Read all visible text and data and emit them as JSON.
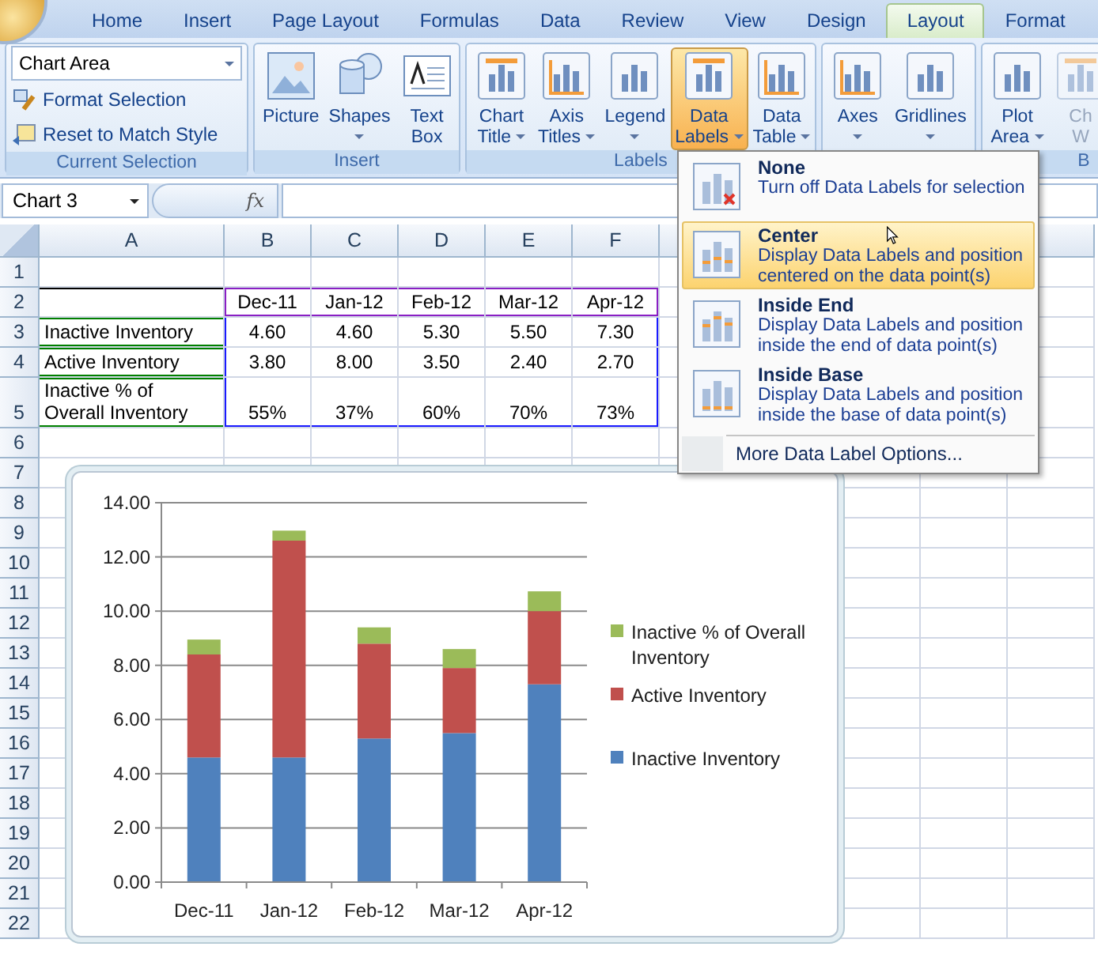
{
  "tabs": [
    {
      "label": "Home",
      "selected": false
    },
    {
      "label": "Insert",
      "selected": false
    },
    {
      "label": "Page Layout",
      "selected": false
    },
    {
      "label": "Formulas",
      "selected": false
    },
    {
      "label": "Data",
      "selected": false
    },
    {
      "label": "Review",
      "selected": false
    },
    {
      "label": "View",
      "selected": false
    },
    {
      "label": "Design",
      "selected": false
    },
    {
      "label": "Layout",
      "selected": true
    },
    {
      "label": "Format",
      "selected": false
    }
  ],
  "ribbon": {
    "selection": {
      "label": "Current Selection",
      "dropdown": "Chart Area",
      "commands": [
        "Format Selection",
        "Reset to Match Style"
      ]
    },
    "groups": [
      {
        "label": "Insert",
        "buttons": [
          {
            "lines": [
              "Picture"
            ],
            "dropdown": false,
            "selected": false,
            "disabled": false
          },
          {
            "lines": [
              "Shapes"
            ],
            "dropdown": true,
            "selected": false,
            "disabled": false
          },
          {
            "lines": [
              "Text",
              "Box"
            ],
            "dropdown": false,
            "selected": false,
            "disabled": false
          }
        ]
      },
      {
        "label": "Labels",
        "buttons": [
          {
            "lines": [
              "Chart",
              "Title"
            ],
            "dropdown": true,
            "selected": false,
            "disabled": false
          },
          {
            "lines": [
              "Axis",
              "Titles"
            ],
            "dropdown": true,
            "selected": false,
            "disabled": false
          },
          {
            "lines": [
              "Legend"
            ],
            "dropdown": true,
            "selected": false,
            "disabled": false
          },
          {
            "lines": [
              "Data",
              "Labels"
            ],
            "dropdown": true,
            "selected": true,
            "disabled": false
          },
          {
            "lines": [
              "Data",
              "Table"
            ],
            "dropdown": true,
            "selected": false,
            "disabled": false
          }
        ]
      },
      {
        "buttons": [
          {
            "lines": [
              "Axes"
            ],
            "dropdown": true,
            "selected": false,
            "disabled": false
          },
          {
            "lines": [
              "Gridlines"
            ],
            "dropdown": true,
            "selected": false,
            "disabled": false
          }
        ]
      },
      {
        "label": "B",
        "buttons": [
          {
            "lines": [
              "Plot",
              "Area"
            ],
            "dropdown": true,
            "selected": false,
            "disabled": false
          },
          {
            "lines": [
              "Ch",
              "W"
            ],
            "dropdown": false,
            "selected": false,
            "disabled": true
          }
        ]
      }
    ]
  },
  "formula_bar": {
    "name_box": "Chart 3",
    "function_label": "fx"
  },
  "sheet": {
    "columns": [
      "A",
      "B",
      "C",
      "D",
      "E",
      "F"
    ],
    "rows": [
      {
        "number": "1"
      },
      {
        "number": "2",
        "values": [
          "Dec-11",
          "Jan-12",
          "Feb-12",
          "Mar-12",
          "Apr-12"
        ]
      },
      {
        "number": "3",
        "label": "Inactive Inventory",
        "values": [
          "4.60",
          "4.60",
          "5.30",
          "5.50",
          "7.30"
        ]
      },
      {
        "number": "4",
        "label": "Active Inventory",
        "values": [
          "3.80",
          "8.00",
          "3.50",
          "2.40",
          "2.70"
        ]
      },
      {
        "number": "5",
        "label": "Inactive % of Overall Inventory",
        "values": [
          "55%",
          "37%",
          "60%",
          "70%",
          "73%"
        ]
      },
      {
        "number": "6"
      },
      {
        "number": "7"
      },
      {
        "number": "8"
      },
      {
        "number": "9"
      },
      {
        "number": "10"
      },
      {
        "number": "11"
      },
      {
        "number": "12"
      },
      {
        "number": "13"
      },
      {
        "number": "14"
      },
      {
        "number": "15"
      },
      {
        "number": "16"
      },
      {
        "number": "17"
      },
      {
        "number": "18"
      },
      {
        "number": "19"
      },
      {
        "number": "20"
      },
      {
        "number": "21"
      },
      {
        "number": "22"
      }
    ]
  },
  "chart": {
    "chart_data": {
      "type": "bar",
      "stacked": true,
      "orientation": "vertical",
      "grid": true,
      "categories": [
        "Dec-11",
        "Jan-12",
        "Feb-12",
        "Mar-12",
        "Apr-12"
      ],
      "series": [
        {
          "name": "Inactive Inventory",
          "color": "#4f81bd",
          "values": [
            4.6,
            4.6,
            5.3,
            5.5,
            7.3
          ]
        },
        {
          "name": "Active Inventory",
          "color": "#c0504d",
          "values": [
            3.8,
            8.0,
            3.5,
            2.4,
            2.7
          ]
        },
        {
          "name": "Inactive % of Overall Inventory",
          "color": "#9bbb59",
          "values": [
            0.55,
            0.37,
            0.6,
            0.7,
            0.73
          ]
        }
      ],
      "ylim": [
        0,
        14
      ],
      "yticks": [
        {
          "value": 0,
          "label": "0.00"
        },
        {
          "value": 2,
          "label": "2.00"
        },
        {
          "value": 4,
          "label": "4.00"
        },
        {
          "value": 6,
          "label": "6.00"
        },
        {
          "value": 8,
          "label": "8.00"
        },
        {
          "value": 10,
          "label": "10.00"
        },
        {
          "value": 12,
          "label": "12.00"
        },
        {
          "value": 14,
          "label": "14.00"
        }
      ]
    }
  },
  "menu": {
    "items": [
      {
        "title": "None",
        "description": "Turn off Data Labels for selection",
        "selected": false
      },
      {
        "title": "Center",
        "description": "Display Data Labels and position centered on the data point(s)",
        "selected": true
      },
      {
        "title": "Inside End",
        "description": "Display Data Labels and position inside the end of data point(s)",
        "selected": false
      },
      {
        "title": "Inside Base",
        "description": "Display Data Labels and position inside the base of data point(s)",
        "selected": false
      }
    ],
    "footer": "More Data Label Options..."
  }
}
